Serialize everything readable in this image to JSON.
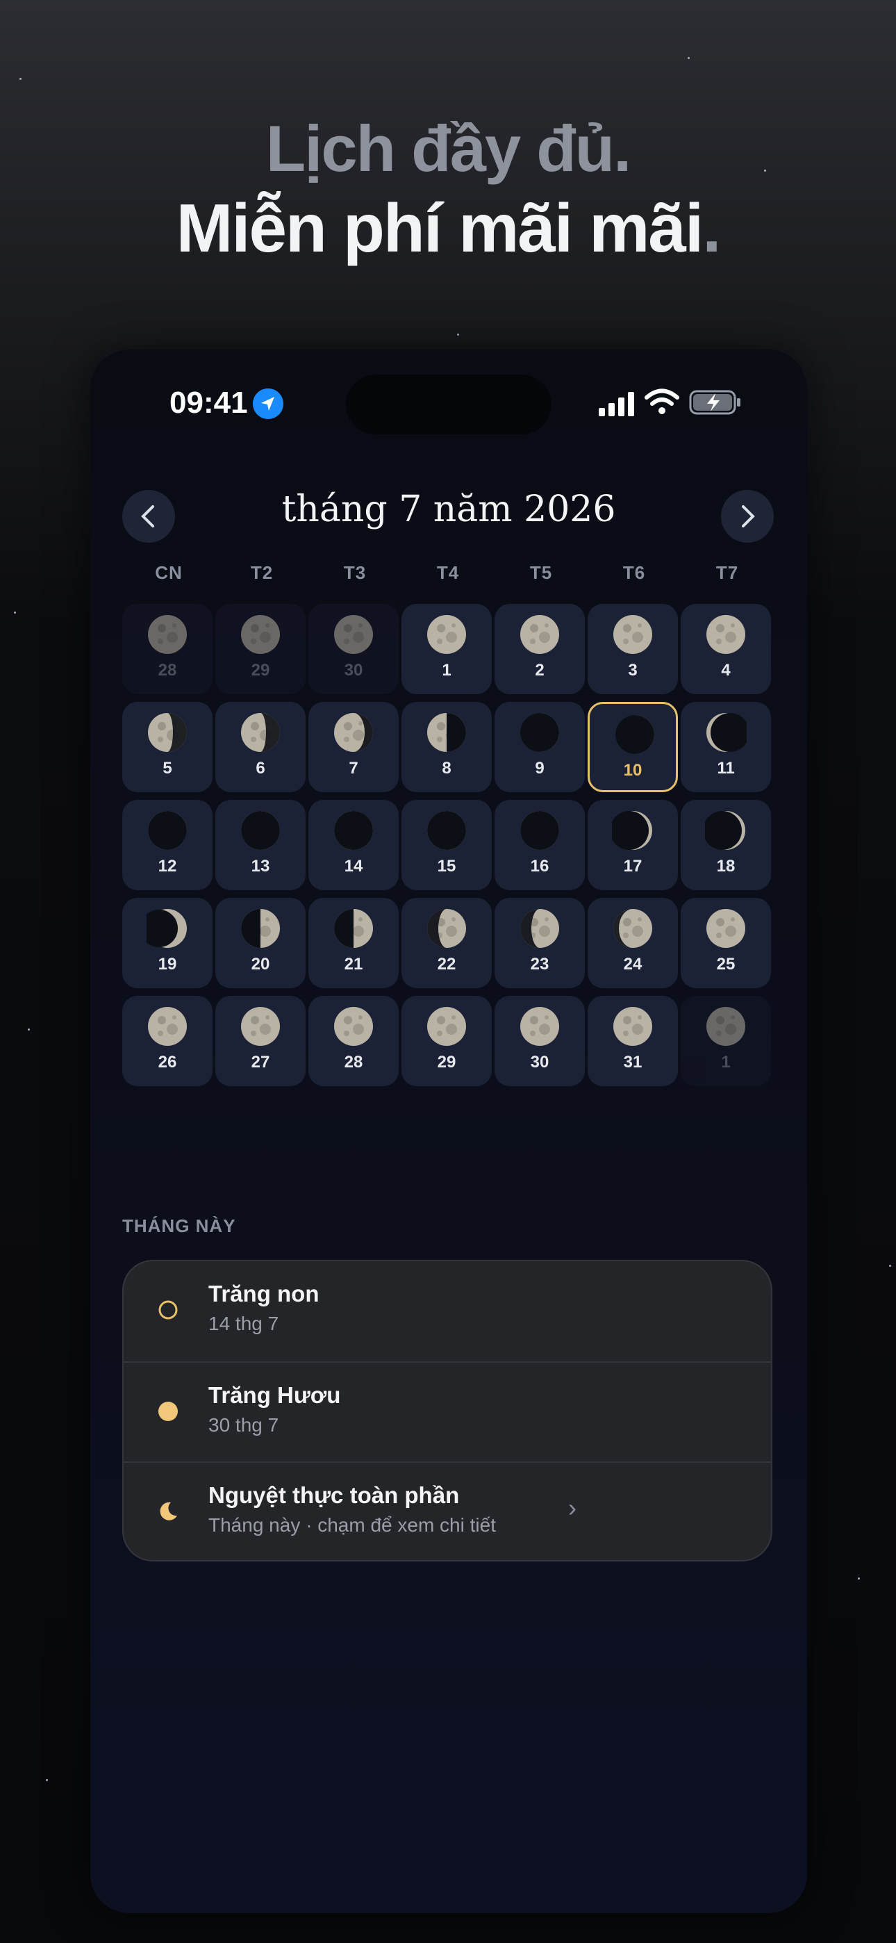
{
  "headline": {
    "line1": "Lịch đầy đủ.",
    "line2": "Miễn phí mãi mãi",
    "line2_dot": "."
  },
  "status_bar": {
    "time": "09:41",
    "icons": [
      "location-arrow-icon",
      "signal-icon",
      "wifi-icon",
      "battery-charging-icon"
    ]
  },
  "calendar": {
    "title": "tháng 7 năm 2026",
    "prev_icon": "chevron-left-icon",
    "next_icon": "chevron-right-icon",
    "weekdays": [
      "CN",
      "T2",
      "T3",
      "T4",
      "T5",
      "T6",
      "T7"
    ],
    "rows": [
      [
        {
          "d": "28",
          "o": true,
          "p": "full"
        },
        {
          "d": "29",
          "o": true,
          "p": "full"
        },
        {
          "d": "30",
          "o": true,
          "p": "full"
        },
        {
          "d": "1",
          "p": "full"
        },
        {
          "d": "2",
          "p": "full"
        },
        {
          "d": "3",
          "p": "full"
        },
        {
          "d": "4",
          "p": "full"
        }
      ],
      [
        {
          "d": "5",
          "p": "gib"
        },
        {
          "d": "6",
          "p": "gib"
        },
        {
          "d": "7",
          "p": "gib2"
        },
        {
          "d": "8",
          "p": "lastq"
        },
        {
          "d": "9",
          "p": "cres"
        },
        {
          "d": "10",
          "p": "cres",
          "today": true
        },
        {
          "d": "11",
          "p": "thin"
        }
      ],
      [
        {
          "d": "12",
          "p": "new"
        },
        {
          "d": "13",
          "p": "new"
        },
        {
          "d": "14",
          "p": "new"
        },
        {
          "d": "15",
          "p": "new"
        },
        {
          "d": "16",
          "p": "new"
        },
        {
          "d": "17",
          "p": "wcres"
        },
        {
          "d": "18",
          "p": "wcres"
        }
      ],
      [
        {
          "d": "19",
          "p": "wcres2"
        },
        {
          "d": "20",
          "p": "firstq"
        },
        {
          "d": "21",
          "p": "firstq"
        },
        {
          "d": "22",
          "p": "wgib"
        },
        {
          "d": "23",
          "p": "wgib"
        },
        {
          "d": "24",
          "p": "wgib2"
        },
        {
          "d": "25",
          "p": "full"
        }
      ],
      [
        {
          "d": "26",
          "p": "full"
        },
        {
          "d": "27",
          "p": "full"
        },
        {
          "d": "28",
          "p": "full"
        },
        {
          "d": "29",
          "p": "full"
        },
        {
          "d": "30",
          "p": "full"
        },
        {
          "d": "31",
          "p": "full"
        },
        {
          "d": "1",
          "o": true,
          "p": "full"
        }
      ]
    ],
    "colors": {
      "today_accent": "#e6c06d",
      "cell_bg": "#1c2235"
    }
  },
  "this_month": {
    "title": "THÁNG NÀY",
    "events": [
      {
        "icon": "new-moon-outline-icon",
        "title": "Trăng non",
        "subtitle": "14 thg 7"
      },
      {
        "icon": "full-moon-dot-icon",
        "title": "Trăng Hươu",
        "subtitle": "30 thg 7"
      },
      {
        "icon": "crescent-moon-icon",
        "title": "Nguyệt thực toàn phần",
        "subtitle": "Tháng này · chạm để xem chi tiết",
        "chevron": "›"
      }
    ]
  }
}
